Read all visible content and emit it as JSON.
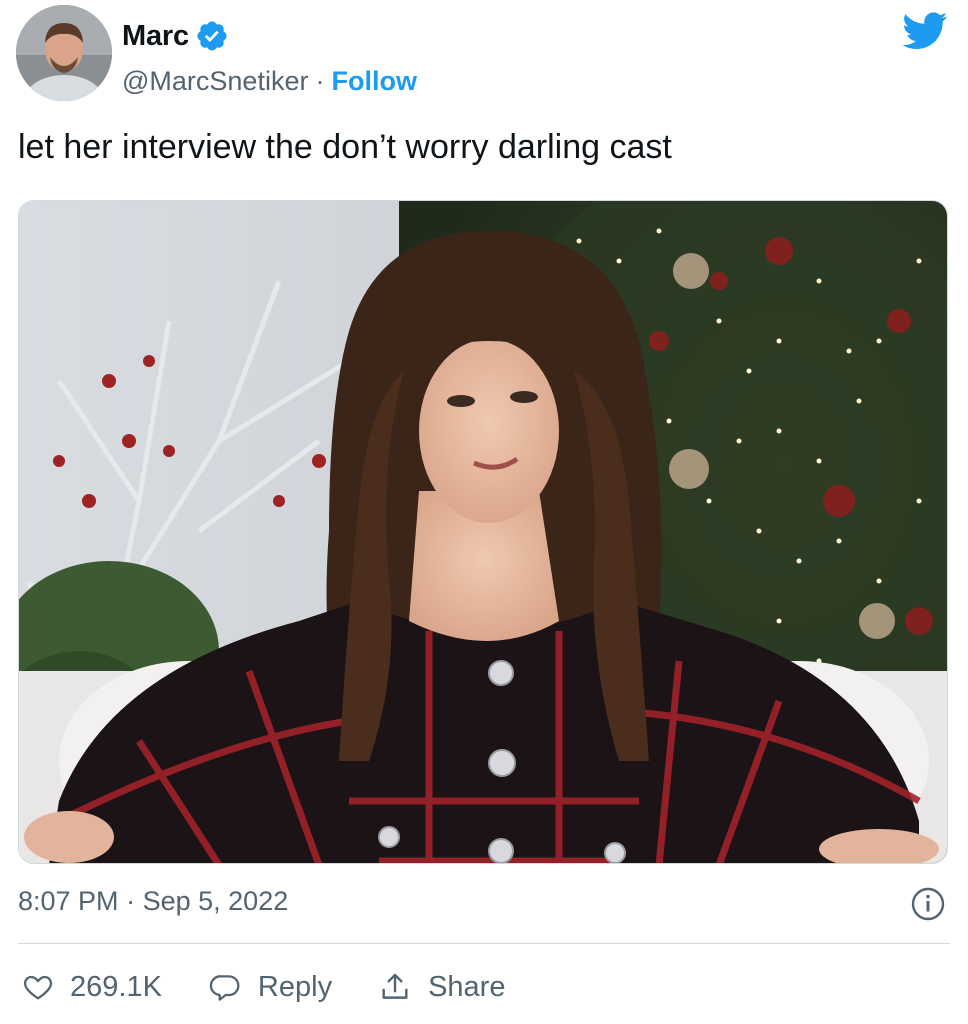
{
  "user": {
    "display_name": "Marc",
    "handle": "@MarcSnetiker",
    "separator": "·",
    "follow_label": "Follow"
  },
  "tweet": {
    "text": "let her interview the don’t worry darling cast",
    "time": "8:07 PM",
    "date_separator": "·",
    "date": "Sep 5, 2022"
  },
  "actions": {
    "like_count": "269.1K",
    "reply_label": "Reply",
    "share_label": "Share"
  },
  "icons": {
    "verified": "verified-badge-icon",
    "brand": "twitter-bird-icon",
    "info": "info-icon",
    "like": "heart-icon",
    "reply": "speech-bubble-icon",
    "share": "share-upload-icon"
  },
  "colors": {
    "accent": "#1d9bf0",
    "text_primary": "#0f1419",
    "text_secondary": "#536471",
    "divider": "#cfd9de"
  }
}
